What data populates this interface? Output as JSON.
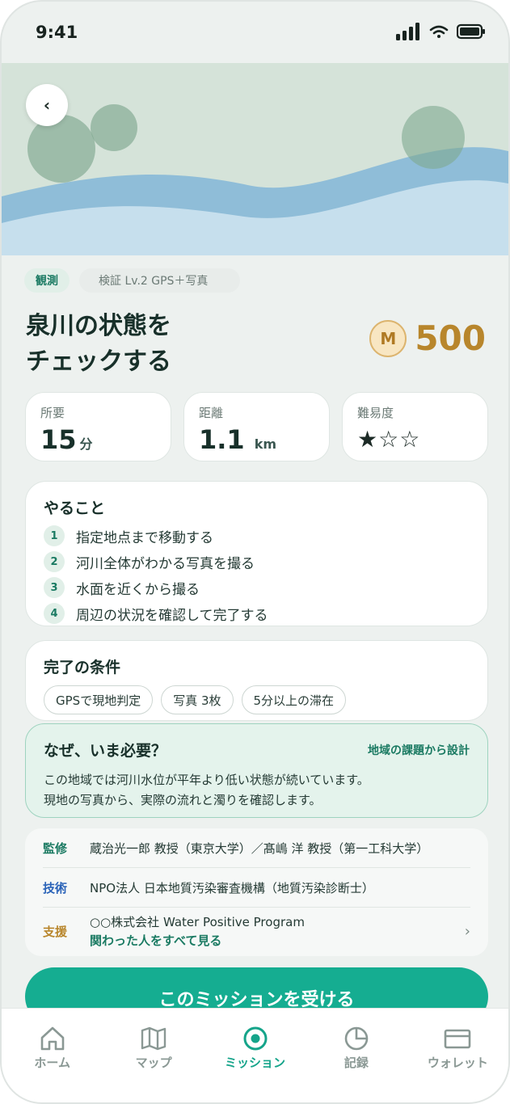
{
  "status_bar": {
    "time": "9:41"
  },
  "mission": {
    "category_tag": "観測",
    "verification_tag": "検証 Lv.2 GPS＋写真",
    "title_line1": "泉川の状態を",
    "title_line2": "チェックする",
    "reward_coin": "M",
    "reward_points": "500"
  },
  "stats": {
    "time": {
      "label": "所要",
      "value": "15",
      "unit": "分"
    },
    "distance": {
      "label": "距離",
      "value": "1.1",
      "unit": "km"
    },
    "difficulty": {
      "label": "難易度",
      "stars": "★☆☆",
      "level": 1,
      "max": 3
    }
  },
  "todo": {
    "title": "やること",
    "steps": [
      {
        "num": "1",
        "text": "指定地点まで移動する"
      },
      {
        "num": "2",
        "text": "河川全体がわかる写真を撮る"
      },
      {
        "num": "3",
        "text": "水面を近くから撮る"
      },
      {
        "num": "4",
        "text": "周辺の状況を確認して完了する"
      }
    ]
  },
  "conditions": {
    "title": "完了の条件",
    "chips": [
      "GPSで現地判定",
      "写真 3枚",
      "5分以上の滞在"
    ]
  },
  "why": {
    "title": "なぜ、いま必要？",
    "tagline": "地域の課題から設計",
    "line1": "この地域では河川水位が平年より低い状態が続いています。",
    "line2": "現地の写真から、実際の流れと濁りを確認します。"
  },
  "credits": {
    "supervision": {
      "role": "監修",
      "text": "蔵治光一郎 教授（東京大学）／髙嶋 洋 教授（第一工科大学）"
    },
    "technology": {
      "role": "技術",
      "text": "NPO法人 日本地質汚染審査機構（地質汚染診断士）"
    },
    "support": {
      "role": "支援",
      "text": "○○株式会社 Water Positive Program",
      "link": "関わった人をすべて見る"
    }
  },
  "cta": {
    "label": "このミッションを受ける"
  },
  "tabs": [
    {
      "label": "ホーム",
      "icon": "home-icon"
    },
    {
      "label": "マップ",
      "icon": "map-icon"
    },
    {
      "label": "ミッション",
      "icon": "target-icon"
    },
    {
      "label": "記録",
      "icon": "pie-chart-icon"
    },
    {
      "label": "ウォレット",
      "icon": "wallet-icon"
    }
  ],
  "colors": {
    "accent": "#15ad91",
    "reward": "#b8862c",
    "background": "#edf1ef"
  }
}
